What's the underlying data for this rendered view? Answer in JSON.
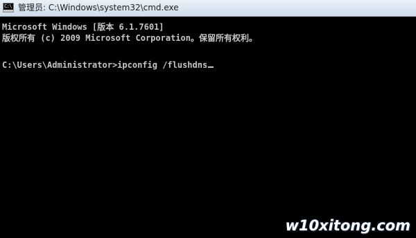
{
  "window": {
    "title": "管理员: C:\\Windows\\system32\\cmd.exe",
    "icon_text": "C:\\"
  },
  "console": {
    "lines": [
      "Microsoft Windows [版本 6.1.7601]",
      "版权所有 (c) 2009 Microsoft Corporation。保留所有权利。",
      "C:\\Users\\Administrator>ipconfig /flushdns"
    ],
    "text_color": "#c6c6c6",
    "background_color": "#000000"
  },
  "watermark": {
    "text": "w10xitong.com"
  }
}
